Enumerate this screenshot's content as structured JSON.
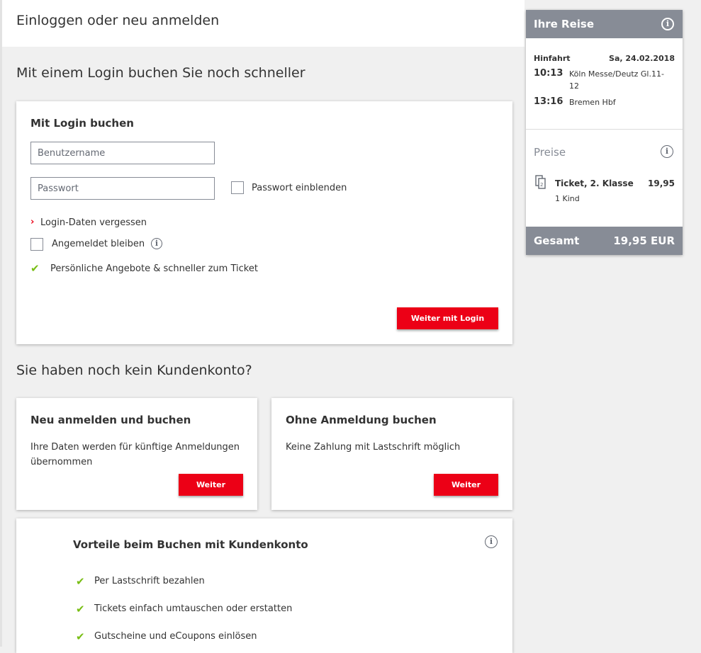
{
  "header": {
    "title": "Einloggen oder neu anmelden"
  },
  "login_section": {
    "title": "Mit einem Login buchen Sie noch schneller",
    "card_title": "Mit Login buchen",
    "username_placeholder": "Benutzername",
    "username_value": "",
    "password_placeholder": "Passwort",
    "password_value": "",
    "show_password_label": "Passwort einblenden",
    "forgot_link": "Login-Daten vergessen",
    "stay_logged_in_label": "Angemeldet bleiben",
    "benefit": "Persönliche Angebote & schneller zum Ticket",
    "submit_label": "Weiter mit Login"
  },
  "no_account_section": {
    "title": "Sie haben noch kein Kundenkonto?",
    "register_card": {
      "title": "Neu anmelden und buchen",
      "text": "Ihre Daten werden für künftige Anmeldungen übernommen",
      "button": "Weiter"
    },
    "guest_card": {
      "title": "Ohne Anmeldung buchen",
      "text": "Keine Zahlung mit Lastschrift möglich",
      "button": "Weiter"
    }
  },
  "benefits_card": {
    "title": "Vorteile beim Buchen mit Kundenkonto",
    "items": [
      "Per Lastschrift bezahlen",
      "Tickets einfach umtauschen oder erstatten",
      "Gutscheine und eCoupons einlösen"
    ]
  },
  "sidebar": {
    "title": "Ihre Reise",
    "direction": "Hinfahrt",
    "date": "Sa, 24.02.2018",
    "departure_time": "10:13",
    "departure_station_line1": "Köln Messe/Deutz Gl.11-",
    "departure_station_line2": "12",
    "arrival_time": "13:16",
    "arrival_station": "Bremen Hbf",
    "prices_title": "Preise",
    "ticket_label": "Ticket, 2. Klasse",
    "ticket_price": "19,95",
    "passenger": "1 Kind",
    "total_label": "Gesamt",
    "total_value": "19,95 EUR"
  },
  "colors": {
    "accent_red": "#ec0016",
    "sidebar_grey": "#878c96",
    "check_green": "#78be14"
  }
}
